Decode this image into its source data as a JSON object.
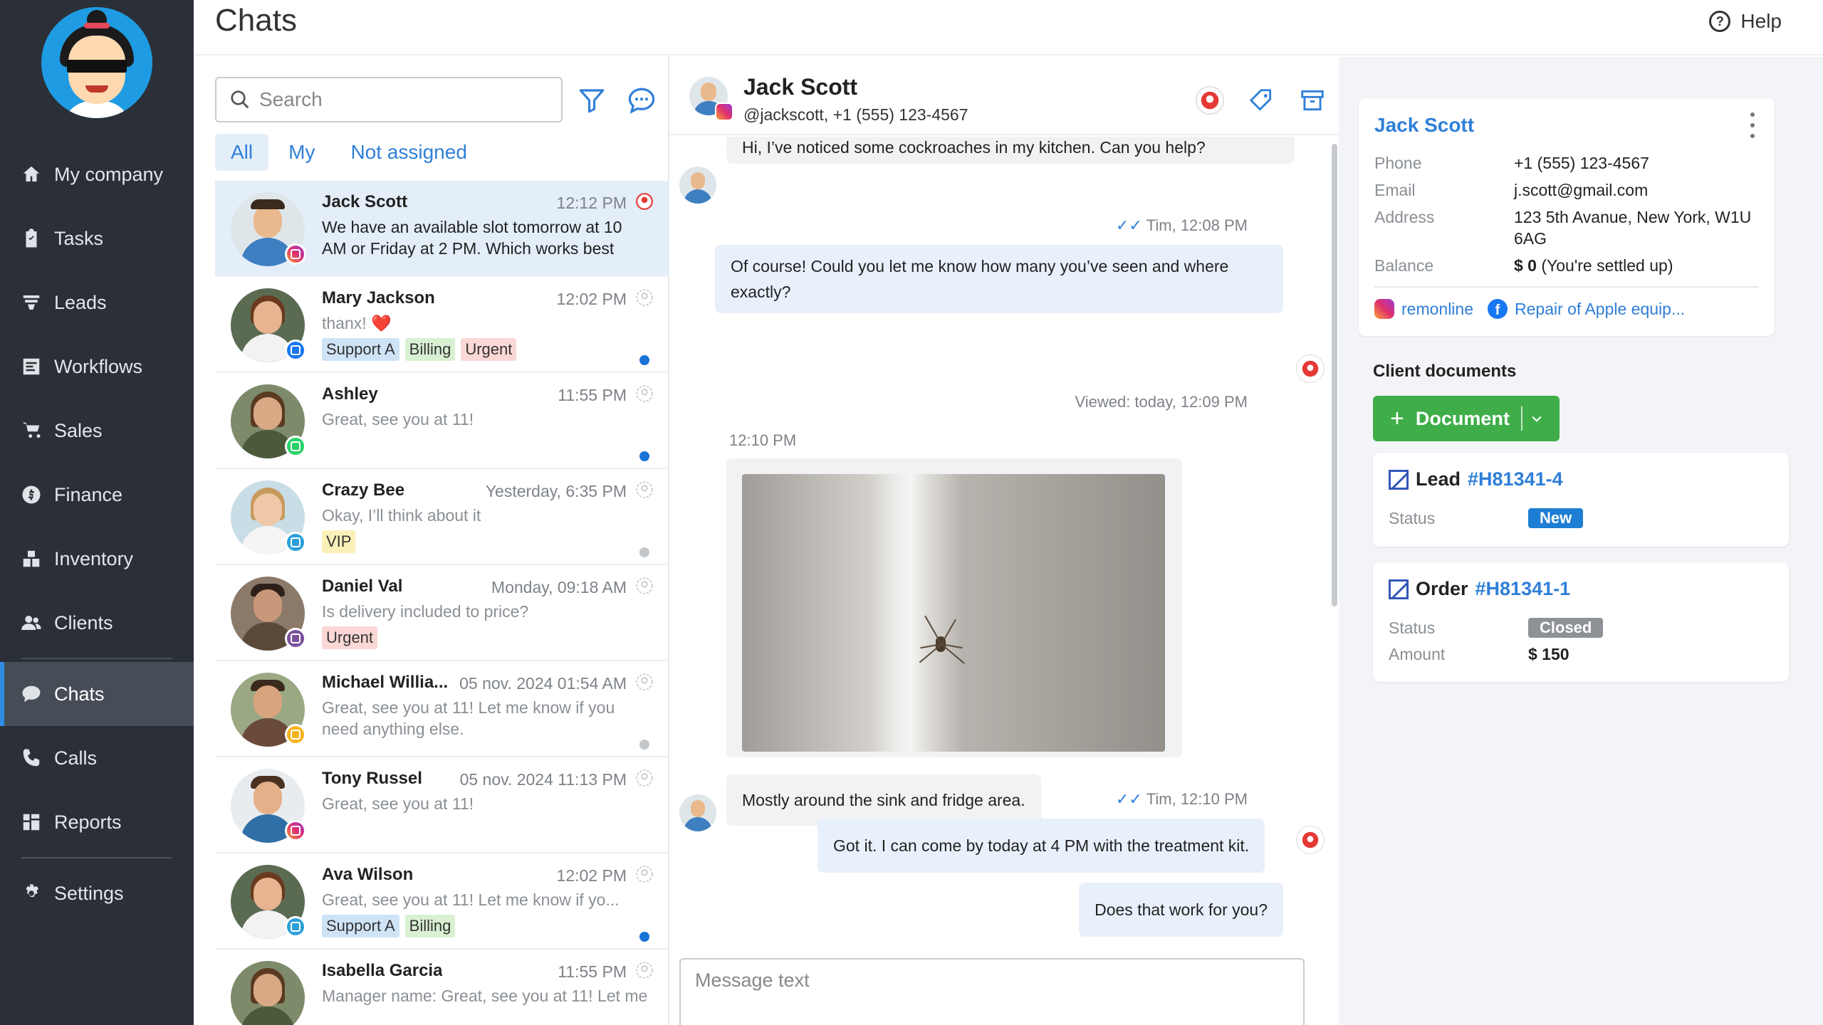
{
  "sidebar": {
    "items": [
      {
        "label": "My company",
        "icon": "home-icon"
      },
      {
        "label": "Tasks",
        "icon": "clipboard-icon"
      },
      {
        "label": "Leads",
        "icon": "funnel-icon"
      },
      {
        "label": "Workflows",
        "icon": "workflow-icon"
      },
      {
        "label": "Sales",
        "icon": "cart-icon"
      },
      {
        "label": "Finance",
        "icon": "dollar-icon"
      },
      {
        "label": "Inventory",
        "icon": "boxes-icon"
      },
      {
        "label": "Clients",
        "icon": "users-icon"
      },
      {
        "label": "Chats",
        "icon": "chat-bubble-icon",
        "active": true
      },
      {
        "label": "Calls",
        "icon": "phone-icon"
      },
      {
        "label": "Reports",
        "icon": "reports-icon"
      },
      {
        "label": "Settings",
        "icon": "gear-icon"
      }
    ]
  },
  "header": {
    "title": "Chats",
    "help": "Help"
  },
  "list": {
    "search_placeholder": "Search",
    "tabs": [
      "All",
      "My",
      "Not assigned"
    ],
    "chats": [
      {
        "name": "Jack Scott",
        "time": "12:12 PM",
        "preview": "We have an available slot tomorrow at 10 AM or Friday at 2 PM. Which works best fo...",
        "channel": "ig",
        "tags": [],
        "selected": true
      },
      {
        "name": "Mary Jackson",
        "time": "12:02 PM",
        "preview": "thanx! ❤️",
        "channel": "fb",
        "tags": [
          {
            "t": "Support A",
            "c": "blue"
          },
          {
            "t": "Billing",
            "c": "green"
          },
          {
            "t": "Urgent",
            "c": "red"
          }
        ],
        "dot": "blue"
      },
      {
        "name": "Ashley",
        "time": "11:55 PM",
        "preview": "Great, see you at 11!",
        "channel": "wa",
        "tags": [],
        "dot": "blue"
      },
      {
        "name": "Crazy Bee",
        "time": "Yesterday, 6:35 PM",
        "preview": "Okay, I’ll think about it",
        "channel": "tg",
        "tags": [
          {
            "t": "VIP",
            "c": "yellow"
          }
        ],
        "dot": "grey"
      },
      {
        "name": "Daniel Val",
        "time": "Monday, 09:18 AM",
        "preview": "Is delivery included to price?",
        "channel": "vb",
        "tags": [
          {
            "t": "Urgent",
            "c": "red"
          }
        ]
      },
      {
        "name": "Michael Willia...",
        "time": "05 nov. 2024 01:54 AM",
        "preview": "Great, see you at 11! Let me know if you need anything else.",
        "channel": "gm",
        "tags": [],
        "dot": "grey"
      },
      {
        "name": "Tony Russel",
        "time": "05 nov. 2024 11:13 PM",
        "preview": "Great, see you at 11!",
        "channel": "ig",
        "tags": []
      },
      {
        "name": "Ava Wilson",
        "time": "12:02 PM",
        "preview": "Great, see you at 11! Let me know if yo...",
        "channel": "tg",
        "tags": [
          {
            "t": "Support A",
            "c": "blue"
          },
          {
            "t": "Billing",
            "c": "green"
          }
        ],
        "dot": "blue"
      },
      {
        "name": "Isabella Garcia",
        "time": "11:55 PM",
        "preview": "Manager name: Great, see you at 11! Let me kn",
        "channel": "",
        "tags": []
      }
    ]
  },
  "conversation": {
    "name": "Jack Scott",
    "sub": "@jackscott, +1 (555) 123-4567",
    "messages": {
      "m1": "Hi, I’ve noticed some cockroaches in my kitchen. Can you help?",
      "meta1": "Tim, 12:08 PM",
      "m2": "Of course! Could you let me know how many you’ve seen and where exactly?",
      "viewed": "Viewed: today, 12:09 PM",
      "time_photo": "12:10 PM",
      "m3": "Mostly around the sink and fridge area.",
      "meta2": "Tim, 12:10 PM",
      "m4": "Got it. I can come by today at 4 PM with the treatment kit.",
      "m5": "Does that work for you?"
    },
    "composer_placeholder": "Message text"
  },
  "client": {
    "name": "Jack Scott",
    "phone_label": "Phone",
    "phone": "+1 (555) 123-4567",
    "email_label": "Email",
    "email": "j.scott@gmail.com",
    "address_label": "Address",
    "address": "123 5th Avanue, New York, W1U 6AG",
    "balance_label": "Balance",
    "balance_amount": "$ 0",
    "balance_note": "(You're settled up)",
    "link_ig": "remonline",
    "link_fb": "Repair of Apple equip...",
    "docs_title": "Client documents",
    "doc_button": "Document",
    "lead": {
      "type": "Lead",
      "num": "#H81341-4",
      "status_label": "Status",
      "status": "New"
    },
    "order": {
      "type": "Order",
      "num": "#H81341-1",
      "status_label": "Status",
      "status": "Closed",
      "amount_label": "Amount",
      "amount": "$ 150"
    }
  },
  "colors": {
    "accent": "#2f7fd8",
    "sidebar": "#2b3038",
    "green": "#3fae49"
  }
}
